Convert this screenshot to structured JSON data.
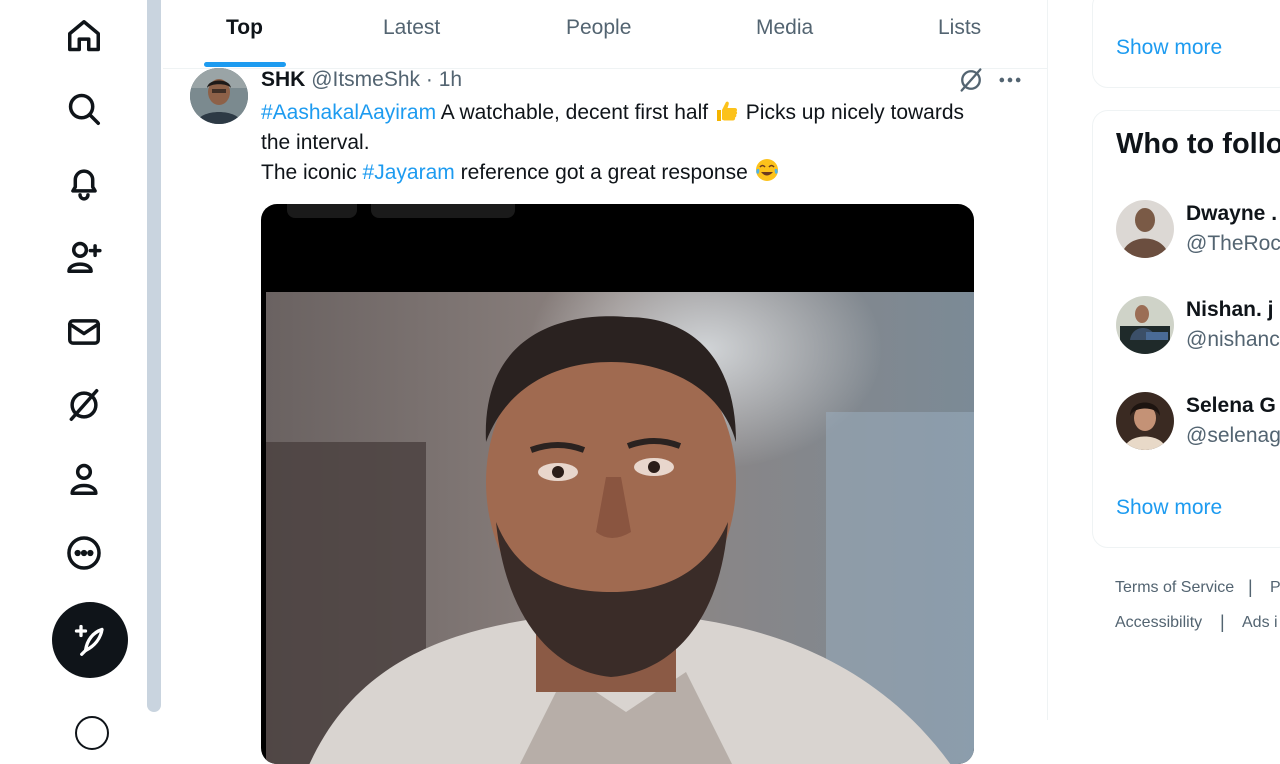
{
  "nav": {
    "items": [
      {
        "name": "home",
        "icon": "home-icon"
      },
      {
        "name": "explore",
        "icon": "search-icon"
      },
      {
        "name": "notifications",
        "icon": "bell-icon"
      },
      {
        "name": "follow",
        "icon": "add-person-icon"
      },
      {
        "name": "messages",
        "icon": "mail-icon"
      },
      {
        "name": "grok",
        "icon": "grok-icon"
      },
      {
        "name": "profile",
        "icon": "person-icon"
      },
      {
        "name": "more",
        "icon": "more-circle-icon"
      }
    ],
    "compose_icon": "feather-plus-icon"
  },
  "tabs": [
    {
      "label": "Top",
      "active": true
    },
    {
      "label": "Latest",
      "active": false
    },
    {
      "label": "People",
      "active": false
    },
    {
      "label": "Media",
      "active": false
    },
    {
      "label": "Lists",
      "active": false
    }
  ],
  "tweet": {
    "name": "SHK",
    "handle": "@ItsmeShk",
    "separator": "·",
    "time": "1h",
    "hashtag1": "#AashakalAayiram",
    "text1": " A watchable, decent first half ",
    "text1b": " Picks up nicely towards the interval.",
    "text2a": "The iconic ",
    "hashtag2": "#Jayaram",
    "text2b": " reference got a great response ",
    "emoji1": "thumbs-up-emoji",
    "emoji2": "tears-of-joy-emoji"
  },
  "sidebar": {
    "show_more_top": "Show more",
    "who_to_follow_title": "Who to follo",
    "follow": [
      {
        "name": "Dwayne .",
        "handle": "@TheRoc"
      },
      {
        "name": "Nishan. j",
        "handle": "@nishanc"
      },
      {
        "name": "Selena G",
        "handle": "@selenag"
      }
    ],
    "show_more_bottom": "Show more",
    "footer": {
      "terms": "Terms of Service",
      "p": "P",
      "accessibility": "Accessibility",
      "ads": "Ads i",
      "sep": "|"
    }
  },
  "colors": {
    "accent": "#1d9bf0",
    "text": "#0f1419",
    "muted": "#536471"
  }
}
